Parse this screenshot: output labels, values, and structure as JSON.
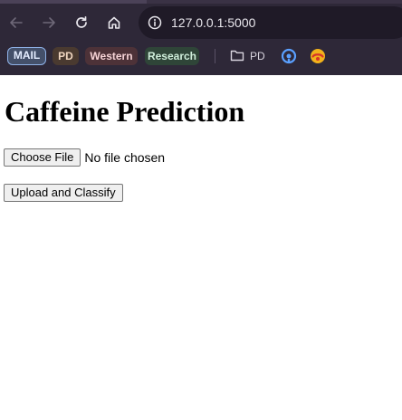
{
  "browser": {
    "address_bar": {
      "url": "127.0.0.1:5000"
    },
    "nav_icons": {
      "back": "back-arrow-icon",
      "forward": "forward-arrow-icon",
      "reload": "reload-icon",
      "home": "home-icon",
      "site_info": "site-info-icon"
    },
    "bookmarks": [
      {
        "label": "MAIL"
      },
      {
        "label": "PD"
      },
      {
        "label": "Western"
      },
      {
        "label": "Research"
      }
    ],
    "bookmark_folder": {
      "label": "PD",
      "icon": "folder-icon"
    },
    "bookmark_icons": [
      "extension-icon",
      "web-app-icon"
    ],
    "colors": {
      "chrome_bg": "#2e2838",
      "address_bg": "#1f1a27"
    }
  },
  "page": {
    "title": "Caffeine Prediction",
    "file_input": {
      "button_label": "Choose File",
      "status_text": "No file chosen"
    },
    "submit_label": "Upload and Classify"
  }
}
